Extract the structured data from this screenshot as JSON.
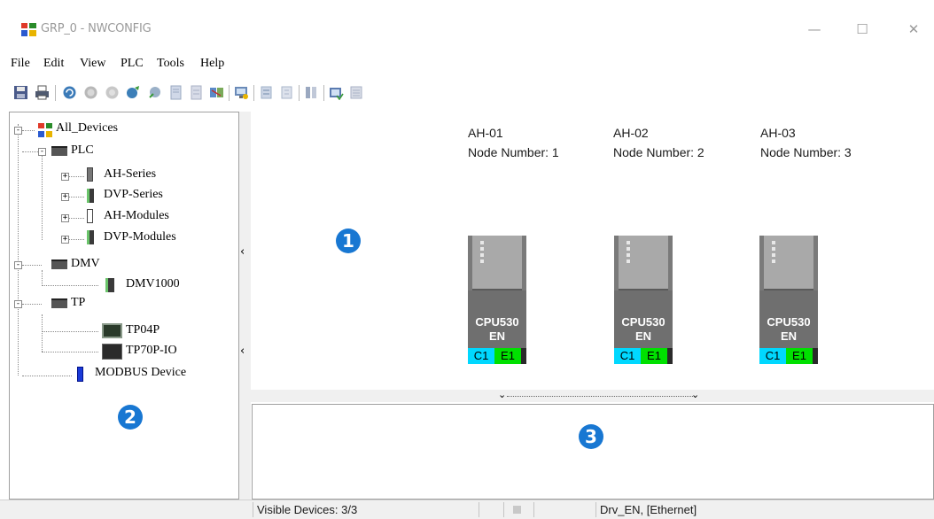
{
  "window": {
    "title": "GRP_0 - NWCONFIG",
    "minimize_glyph": "—",
    "maximize_glyph": "☐",
    "close_glyph": "✕"
  },
  "menu": [
    "File",
    "Edit",
    "View",
    "PLC",
    "Tools",
    "Help"
  ],
  "toolbar": {
    "icons": [
      "save-icon",
      "print-icon",
      "refresh-icon",
      "stop-icon",
      "network-icon",
      "scan-icon",
      "upload-icon",
      "download-icon",
      "tools-icon",
      "parameter-icon",
      "monitor-icon",
      "online-icon",
      "offline-icon",
      "compile-icon",
      "check-icon"
    ]
  },
  "tree": {
    "root": "All_Devices",
    "groups": [
      {
        "label": "PLC",
        "children": [
          "AH-Series",
          "DVP-Series",
          "AH-Modules",
          "DVP-Modules"
        ]
      },
      {
        "label": "DMV",
        "children": [
          "DMV1000"
        ]
      },
      {
        "label": "TP",
        "children": [
          "TP04P",
          "TP70P-IO"
        ]
      }
    ],
    "extra": "MODBUS Device"
  },
  "devices": [
    {
      "name": "AH-01",
      "node": "Node Number: 1",
      "cpu": "CPU530",
      "sub": "EN",
      "port_c": "C1",
      "port_e": "E1"
    },
    {
      "name": "AH-02",
      "node": "Node Number: 2",
      "cpu": "CPU530",
      "sub": "EN",
      "port_c": "C1",
      "port_e": "E1"
    },
    {
      "name": "AH-03",
      "node": "Node Number: 3",
      "cpu": "CPU530",
      "sub": "EN",
      "port_c": "C1",
      "port_e": "E1"
    }
  ],
  "badges": [
    "1",
    "2",
    "3"
  ],
  "statusbar": {
    "visible_devices": "Visible Devices: 3/3",
    "driver": "Drv_EN, [Ethernet]"
  },
  "colors": {
    "badge": "#1877d2",
    "port_c": "#00d8ff",
    "port_e": "#00e000"
  }
}
